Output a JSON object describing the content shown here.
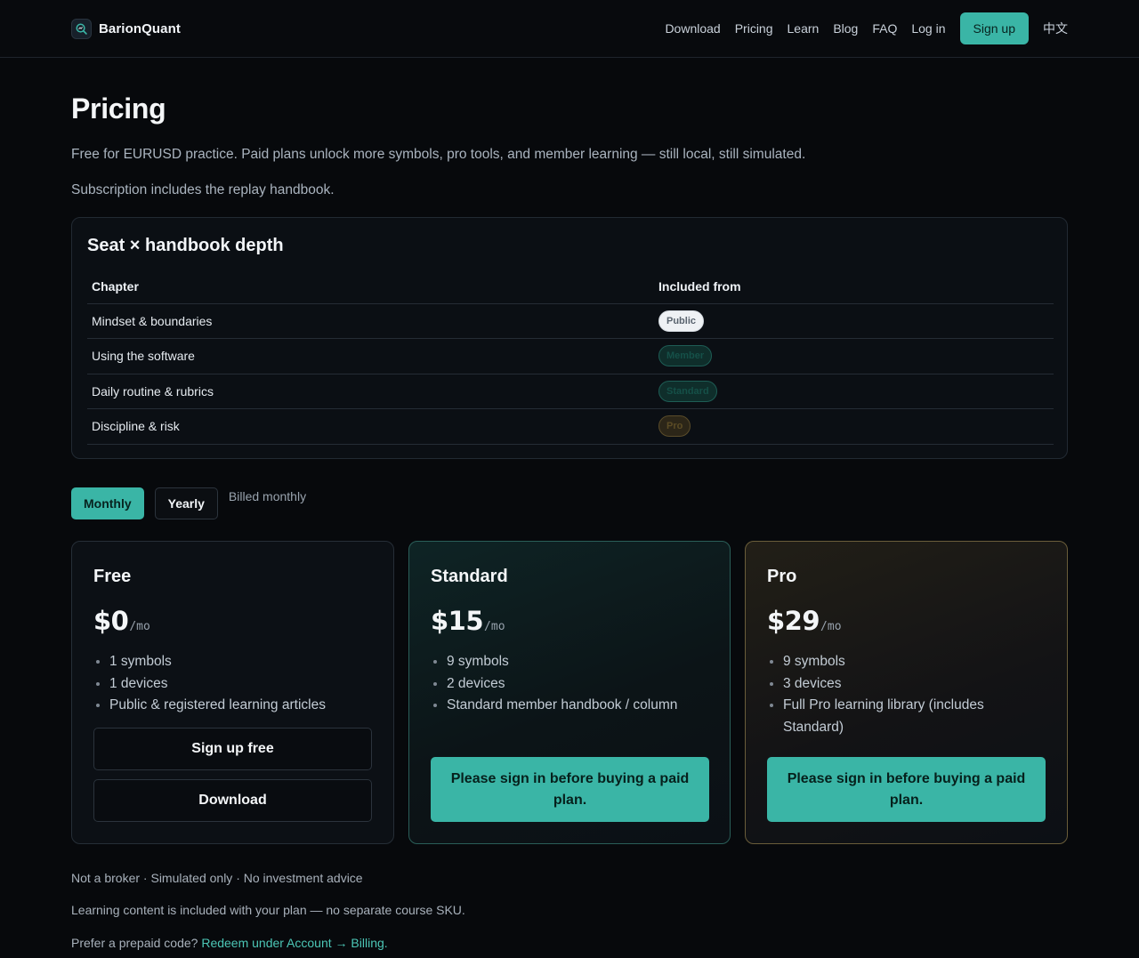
{
  "header": {
    "brand_name": "BarionQuant",
    "logo_icon": "magnifier-logo-icon",
    "nav": [
      "Download",
      "Pricing",
      "Learn",
      "Blog",
      "FAQ",
      "Log in"
    ],
    "signup_label": "Sign up",
    "language_label": "中文"
  },
  "page": {
    "title": "Pricing",
    "intro": "Free for EURUSD practice. Paid plans unlock more symbols, pro tools, and member learning — still local, still simulated.",
    "intro_secondary": "Subscription includes the replay handbook."
  },
  "handbook": {
    "title": "Seat × handbook depth",
    "columns": [
      "Chapter",
      "Included from"
    ],
    "rows": [
      {
        "chapter": "Mindset & boundaries",
        "tier": "Public"
      },
      {
        "chapter": "Using the software",
        "tier": "Member"
      },
      {
        "chapter": "Daily routine & rubrics",
        "tier": "Standard"
      },
      {
        "chapter": "Discipline & risk",
        "tier": "Pro"
      }
    ]
  },
  "billing": {
    "monthly_label": "Monthly",
    "yearly_label": "Yearly",
    "note": "Billed monthly",
    "selected": "Monthly"
  },
  "plans": [
    {
      "name": "Free",
      "price": "$0",
      "unit": "/mo",
      "features": [
        "1 symbols",
        "1 devices",
        "Public & registered learning articles"
      ],
      "primary_cta": "Sign up free",
      "secondary_cta": "Download"
    },
    {
      "name": "Standard",
      "price": "$15",
      "unit": "/mo",
      "features": [
        "9 symbols",
        "2 devices",
        "Standard member handbook / column"
      ],
      "cta": "Please sign in before buying a paid plan."
    },
    {
      "name": "Pro",
      "price": "$29",
      "unit": "/mo",
      "features": [
        "9 symbols",
        "3 devices",
        "Full Pro learning library (includes Standard)"
      ],
      "cta": "Please sign in before buying a paid plan."
    }
  ],
  "footer": {
    "disclaimer": "Not a broker · Simulated only · No investment advice",
    "learning_note": "Learning content is included with your plan — no separate course SKU.",
    "prepaid_prefix": "Prefer a prepaid code? ",
    "prepaid_link": "Redeem under Account → Billing."
  },
  "colors": {
    "accent": "#3ab5a6",
    "background": "#07090c",
    "pro_border": "#6a5d3a",
    "standard_border": "#2a5e58"
  }
}
